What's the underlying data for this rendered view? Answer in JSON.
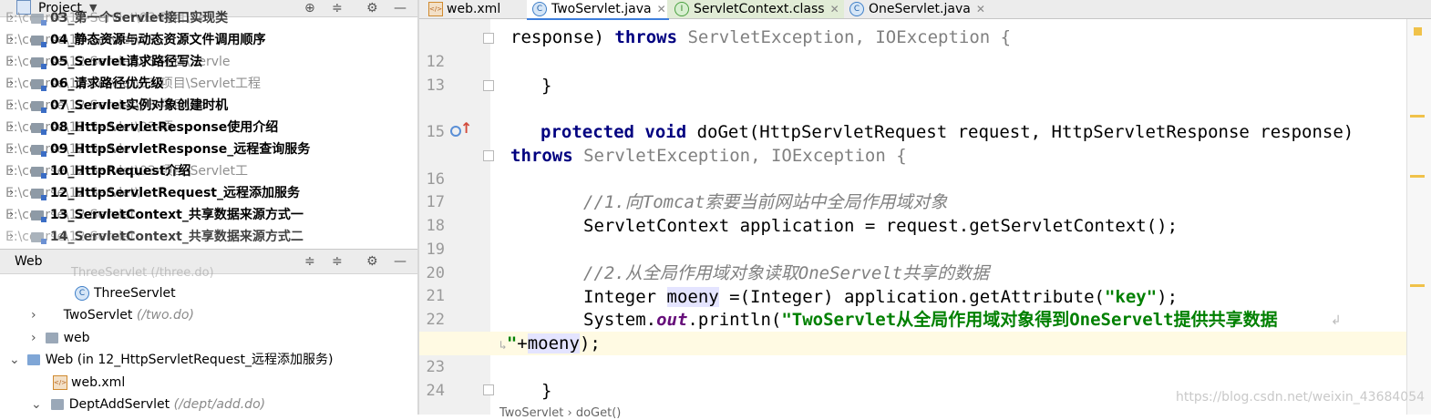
{
  "project_panel": {
    "title": "Project",
    "items": [
      {
        "name": "03_第一个Servlet接口实现类",
        "path": "E:\\course\\12-Servlet\\03-项目\\Se"
      },
      {
        "name": "04_静态资源与动态资源文件调用顺序",
        "path": "E:\\course\\12-Servlet\\03-"
      },
      {
        "name": "05_Servlet请求路径写法",
        "path": "E:\\course\\12-Servlet\\03-项目\\Servle"
      },
      {
        "name": "06_请求路径优先级",
        "path": "E:\\course\\12-Servlet\\03-项目\\Servlet工程"
      },
      {
        "name": "07_Servlet实例对象创建时机",
        "path": "E:\\course\\12-Servlet\\03-项目\\Se"
      },
      {
        "name": "08_HttpServletResponse使用介绍",
        "path": "E:\\course\\12-Servlet\\03-项"
      },
      {
        "name": "09_HttpServletResponse_远程查询服务",
        "path": "E:\\course\\12-Servle"
      },
      {
        "name": "10_HttpRequest介绍",
        "path": "E:\\course\\12-Servlet\\03-项目\\Servlet工"
      },
      {
        "name": "12_HttpServletRequest_远程添加服务",
        "path": "E:\\course\\12-Servlet\\"
      },
      {
        "name": "13_ServletContext_共享数据来源方式一",
        "path": "E:\\course\\12-Servlet"
      },
      {
        "name": "14_ServletContext_共享数据来源方式二",
        "path": "E:\\course\\12-Servlet"
      }
    ]
  },
  "web_panel": {
    "title": "Web",
    "partial_top": "ThreeServlet (/three.do)",
    "three_servlet": "ThreeServlet",
    "two_servlet": "TwoServlet",
    "two_servlet_path": "(/two.do)",
    "web_folder": "web",
    "web_module": "Web (in 12_HttpServletRequest_远程添加服务)",
    "web_xml": "web.xml",
    "dept_add": "DeptAddServlet",
    "dept_add_path": "(/dept/add.do)"
  },
  "tabs": [
    {
      "label": "web.xml"
    },
    {
      "label": "TwoServlet.java"
    },
    {
      "label": "ServletContext.class"
    },
    {
      "label": "OneServlet.java"
    }
  ],
  "editor": {
    "line_numbers": [
      "12",
      "13",
      "15",
      "16",
      "17",
      "18",
      "19",
      "20",
      "21",
      "22",
      "23",
      "24"
    ],
    "lines": {
      "l0_a": "response) ",
      "l0_kw": "throws",
      "l0_b": " ServletException, IOException {",
      "l13": "}",
      "l15_kw": "protected void",
      "l15_rest": " doGet(HttpServletRequest request, HttpServletResponse response)",
      "l15b_kw": "throws",
      "l15b_rest": " ServletException, IOException {",
      "l17": "//1.向Tomcat索要当前网站中全局作用域对象",
      "l18": "ServletContext application = request.getServletContext();",
      "l20": "//2.从全局作用域对象读取OneServelt共享的数据",
      "l21_a": "Integer ",
      "l21_var": "moeny",
      "l21_b": " =(Integer) application.getAttribute(",
      "l21_str": "\"key\"",
      "l21_c": ");",
      "l22_a": "System.",
      "l22_out": "out",
      "l22_b": ".println(",
      "l22_str": "\"TwoServlet从全局作用域对象得到OneServelt提供共享数据",
      "l22w_str": "\"",
      "l22w_b": "+",
      "l22w_var": "moeny",
      "l22w_c": ");",
      "l24": "}"
    }
  },
  "breadcrumb": "TwoServlet  ›  doGet()",
  "watermark": "https://blog.csdn.net/weixin_43684054",
  "colors": {
    "keyword": "#000080",
    "string": "#008000",
    "comment": "#808080",
    "caret_line": "#fffae3",
    "tab_active": "#3d7edc"
  }
}
